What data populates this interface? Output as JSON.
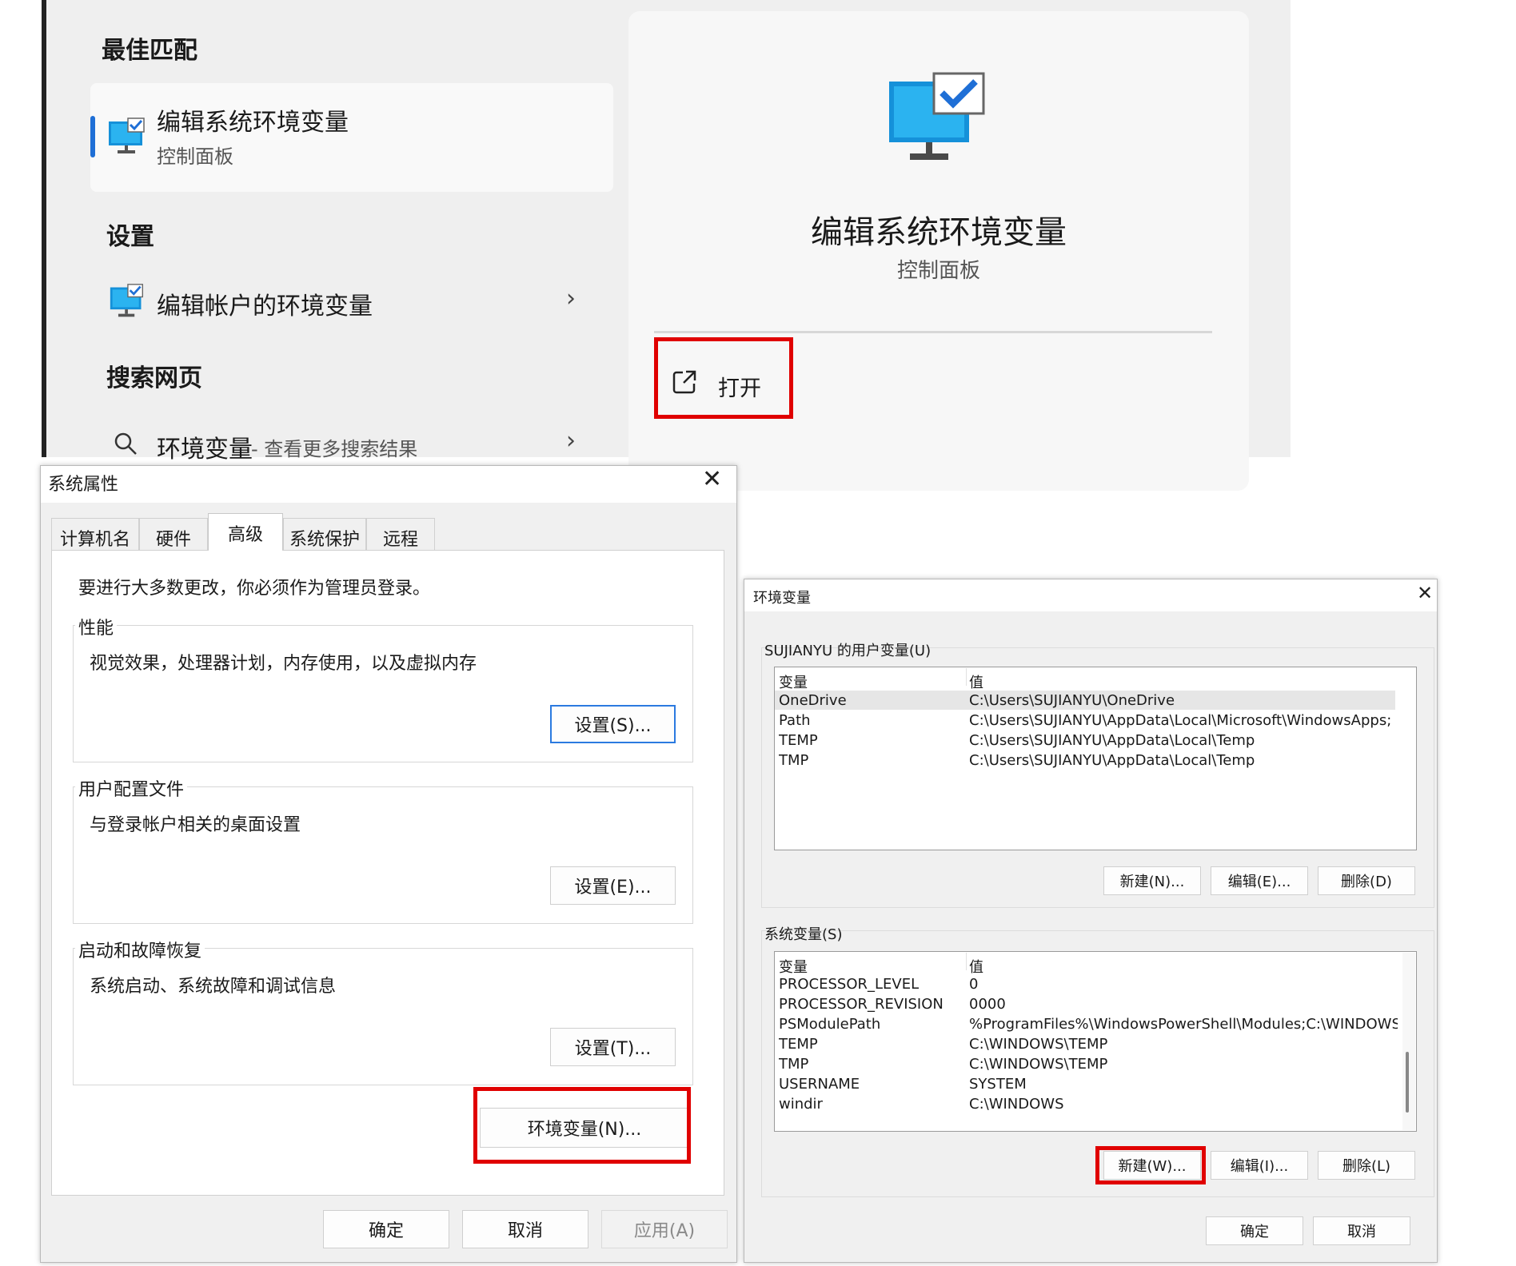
{
  "search": {
    "best_match_heading": "最佳匹配",
    "best_match": {
      "title": "编辑系统环境变量",
      "subtitle": "控制面板",
      "icon": "monitor-check-icon"
    },
    "settings_heading": "设置",
    "settings_item": {
      "title": "编辑帐户的环境变量",
      "icon": "monitor-check-icon"
    },
    "web_heading": "搜索网页",
    "web_item": {
      "title": "环境变量",
      "subtitle": "- 查看更多搜索结果",
      "icon": "search-icon"
    },
    "preview": {
      "title": "编辑系统环境变量",
      "subtitle": "控制面板",
      "open_label": "打开",
      "open_icon": "open-external-icon"
    }
  },
  "sysprops": {
    "title": "系统属性",
    "tabs": [
      "计算机名",
      "硬件",
      "高级",
      "系统保护",
      "远程"
    ],
    "active_tab": "高级",
    "admin_note": "要进行大多数更改，你必须作为管理员登录。",
    "performance": {
      "label": "性能",
      "desc": "视觉效果，处理器计划，内存使用，以及虚拟内存",
      "button": "设置(S)..."
    },
    "profile": {
      "label": "用户配置文件",
      "desc": "与登录帐户相关的桌面设置",
      "button": "设置(E)..."
    },
    "startup": {
      "label": "启动和故障恢复",
      "desc": "系统启动、系统故障和调试信息",
      "button": "设置(T)..."
    },
    "env_button": "环境变量(N)...",
    "ok": "确定",
    "cancel": "取消",
    "apply": "应用(A)"
  },
  "envvars": {
    "title": "环境变量",
    "user_label": "SUJIANYU 的用户变量(U)",
    "col_var": "变量",
    "col_val": "值",
    "user_rows": [
      {
        "name": "OneDrive",
        "value": "C:\\Users\\SUJIANYU\\OneDrive"
      },
      {
        "name": "Path",
        "value": "C:\\Users\\SUJIANYU\\AppData\\Local\\Microsoft\\WindowsApps;"
      },
      {
        "name": "TEMP",
        "value": "C:\\Users\\SUJIANYU\\AppData\\Local\\Temp"
      },
      {
        "name": "TMP",
        "value": "C:\\Users\\SUJIANYU\\AppData\\Local\\Temp"
      }
    ],
    "user_buttons": [
      "新建(N)...",
      "编辑(E)...",
      "删除(D)"
    ],
    "sys_label": "系统变量(S)",
    "sys_rows": [
      {
        "name": "PROCESSOR_LEVEL",
        "value": "0"
      },
      {
        "name": "PROCESSOR_REVISION",
        "value": "0000"
      },
      {
        "name": "PSModulePath",
        "value": "%ProgramFiles%\\WindowsPowerShell\\Modules;C:\\WINDOWS\\s..."
      },
      {
        "name": "TEMP",
        "value": "C:\\WINDOWS\\TEMP"
      },
      {
        "name": "TMP",
        "value": "C:\\WINDOWS\\TEMP"
      },
      {
        "name": "USERNAME",
        "value": "SYSTEM"
      },
      {
        "name": "windir",
        "value": "C:\\WINDOWS"
      }
    ],
    "sys_buttons": [
      "新建(W)...",
      "编辑(I)...",
      "删除(L)"
    ],
    "ok": "确定",
    "cancel": "取消"
  },
  "colors": {
    "highlight_red": "#e00000",
    "accent_blue": "#1f6fd6"
  }
}
